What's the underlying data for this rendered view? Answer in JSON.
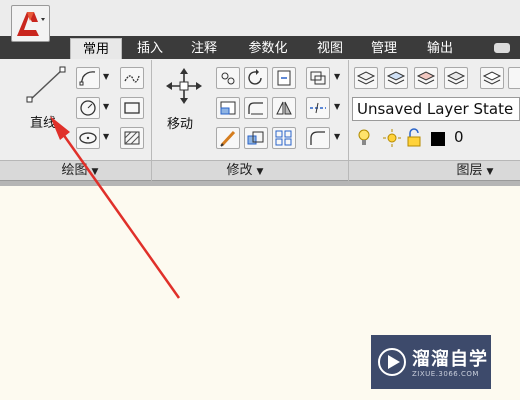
{
  "tabs": [
    "常用",
    "插入",
    "注释",
    "参数化",
    "视图",
    "管理",
    "输出"
  ],
  "tool_line_label": "直线",
  "tool_move_label": "移动",
  "panels": {
    "draw": "绘图",
    "modify": "修改",
    "layers": "图层"
  },
  "layer_state": "Unsaved Layer State",
  "current_layer": "0",
  "watermark": {
    "name": "溜溜自学",
    "url": "ZIXUE.3066.COM"
  },
  "colors": {
    "arrow": "#e0302a",
    "app_logo": "#c9261e",
    "canvas": "#fdfaf0",
    "tab_bar": "#3b3b3b"
  },
  "icons": [
    "autocad-logo-icon",
    "line-icon",
    "polyline-icon",
    "circle-icon",
    "ellipse-icon",
    "arc-icon",
    "rectangle-icon",
    "hatch-icon",
    "move-icon",
    "layer-properties-icon",
    "light-bulb-icon",
    "sun-icon",
    "lock-icon"
  ]
}
